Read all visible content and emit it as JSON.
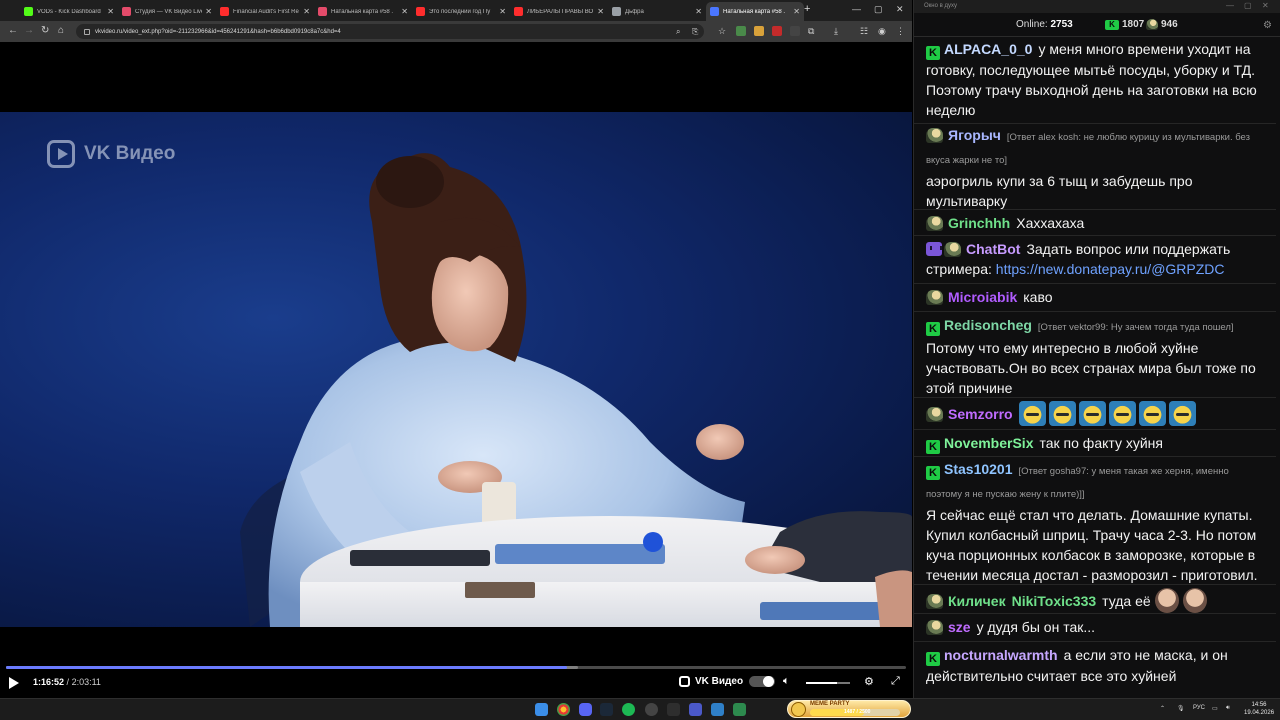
{
  "browser": {
    "tabs": [
      {
        "title": "VODs - Kick Dashboard",
        "color": "#53fc18"
      },
      {
        "title": "Студия — VK Видео Live",
        "color": "#e44b6a"
      },
      {
        "title": "Financial Audit's First Re",
        "color": "#ff2d2d"
      },
      {
        "title": "Натальная карта #58 .",
        "color": "#e44b6a"
      },
      {
        "title": "Это последний год Пу",
        "color": "#ff2d2d"
      },
      {
        "title": "ЛИБЕРАЛЫ ПРАВЫ ВО",
        "color": "#ff2d2d"
      },
      {
        "title": "Дьфра",
        "color": "#9aa0a6"
      },
      {
        "title": "Натальная карта #58 .",
        "color": "#4a76ff",
        "active": true
      }
    ],
    "url": "vkvideo.ru/video_ext.php?oid=-211232966&id=456241291&hash=b6b6dbd0919c8a7c&hd=4"
  },
  "video": {
    "watermark": "VK Видео",
    "current_time": "1:16:52",
    "duration": "2:03:11",
    "progress": 0.623,
    "buffered": 0.635,
    "brand": "VK Видео",
    "volume": 0.7
  },
  "chat": {
    "window_title": "Окно в духу",
    "online_label": "Online:",
    "online_count": "2753",
    "kick_count": "1807",
    "other_count": "946",
    "messages": [
      {
        "badge": "kick",
        "user": "ALPACA_0_0",
        "color": "#c4d9ff",
        "text": "у меня много времени уходит на готовку, последующее мытьё посуды, уборку и ТД. Поэтому трачу выходной день на заготовки на всю неделю"
      },
      {
        "badge": "avatar",
        "user": "Ягорыч",
        "color": "#a9b7ff",
        "reply": "[Ответ alex kosh: не люблю курицу из мультиварки. без вкуса жарки не то]",
        "text": "аэрогриль купи за 6 тыщ и забудешь про мультиварку"
      },
      {
        "badge": "avatar",
        "user": "Grinchhh",
        "color": "#6fe08a",
        "text": "Хаххахаха"
      },
      {
        "badge": "bot",
        "user": "ChatBot",
        "color": "#c79bff",
        "text": "Задать вопрос или поддержать стримера:",
        "link": "https://new.donatepay.ru/@GRPZDC"
      },
      {
        "badge": "avatar",
        "user": "Microiabik",
        "color": "#b15cff",
        "text": "каво"
      },
      {
        "badge": "kick",
        "user": "Redisoncheg",
        "color": "#7ed7a6",
        "reply": "[Ответ vektor99: Ну зачем тогда туда пошел]",
        "text": "Потому что ему интересно в любой хуйне участвовать.Он во всех странах мира был тоже по этой причине"
      },
      {
        "badge": "avatar",
        "user": "Semzorro",
        "color": "#c06cff",
        "text": ""
      },
      {
        "badge": "kick",
        "user": "NovemberSix",
        "color": "#7ff29a",
        "text": "так по факту хуйня"
      },
      {
        "badge": "kick",
        "user": "Stas10201",
        "color": "#8fc4ff",
        "reply": "[Ответ gosha97: у меня такая же херня, именно поэтому я не пускаю жену к плите)]]",
        "text": "Я сейчас ещё стал что делать. Домашние купаты. Купил колбасный шприц. Трачу часа 2-3. Но потом куча порционных колбасок в заморозке, которые в течении месяца достал - разморозил - приготовил."
      },
      {
        "badge": "avatar",
        "user": "Киличек",
        "color": "#6fe08a",
        "user2": "NikiToxic333",
        "color2": "#6fe08a",
        "text": "туда её"
      },
      {
        "badge": "avatar",
        "user": "sze",
        "color": "#c06cff",
        "text": "у дудя бы он так..."
      },
      {
        "badge": "kick",
        "user": "nocturnalwarmth",
        "color": "#c6a7ff",
        "text": "а если это не маска, и он действительно считает все это хуйней"
      }
    ]
  },
  "taskbar": {
    "meme_label": "MEME PARTY",
    "meme_value": "1487 / 2500",
    "meme_fill": 0.6,
    "lang": "РУС",
    "time": "14:56",
    "date": "19.04.2026"
  }
}
